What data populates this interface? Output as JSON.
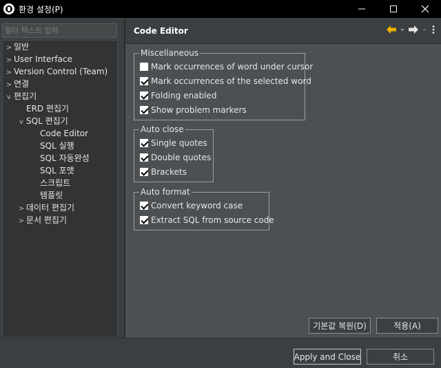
{
  "window": {
    "title": "환경 설정(P)"
  },
  "filter": {
    "placeholder": "필터 텍스트 입력"
  },
  "tree": [
    {
      "label": "일반",
      "chevron": ">"
    },
    {
      "label": "User Interface",
      "chevron": ">"
    },
    {
      "label": "Version Control (Team)",
      "chevron": ">"
    },
    {
      "label": "연결",
      "chevron": ">"
    },
    {
      "label": "편집기",
      "chevron": "v"
    },
    {
      "label": "ERD 편집기",
      "chevron": ""
    },
    {
      "label": "SQL 편집기",
      "chevron": "v"
    },
    {
      "label": "Code Editor",
      "chevron": ""
    },
    {
      "label": "SQL 실행",
      "chevron": ""
    },
    {
      "label": "SQL 자동완성",
      "chevron": ""
    },
    {
      "label": "SQL 포맷",
      "chevron": ""
    },
    {
      "label": "스크립트",
      "chevron": ""
    },
    {
      "label": "템플릿",
      "chevron": ""
    },
    {
      "label": "데이터 편집기",
      "chevron": ">"
    },
    {
      "label": "문서 편집기",
      "chevron": ">"
    }
  ],
  "page": {
    "title": "Code Editor"
  },
  "groups": {
    "misc": {
      "legend": "Miscellaneous",
      "options": [
        {
          "label": "Mark occurrences of word under cursor",
          "checked": false
        },
        {
          "label": "Mark occurrences of the selected word",
          "checked": true
        },
        {
          "label": "Folding enabled",
          "checked": true
        },
        {
          "label": "Show problem markers",
          "checked": true
        }
      ]
    },
    "autoclose": {
      "legend": "Auto close",
      "options": [
        {
          "label": "Single quotes",
          "checked": true
        },
        {
          "label": "Double quotes",
          "checked": true
        },
        {
          "label": "Brackets",
          "checked": true
        }
      ]
    },
    "autoformat": {
      "legend": "Auto format",
      "options": [
        {
          "label": "Convert keyword case",
          "checked": true
        },
        {
          "label": "Extract SQL from source code",
          "checked": true
        }
      ]
    }
  },
  "buttons": {
    "restore_defaults": "기본값 복원(D)",
    "apply": "적용(A)",
    "apply_and_close": "Apply and Close",
    "cancel": "취소"
  },
  "colors": {
    "titlebar": "#000000",
    "pane": "#3c3f41",
    "content": "#4c5052",
    "back_arrow": "#f0b400",
    "forward_arrow": "#e6e6e6"
  }
}
